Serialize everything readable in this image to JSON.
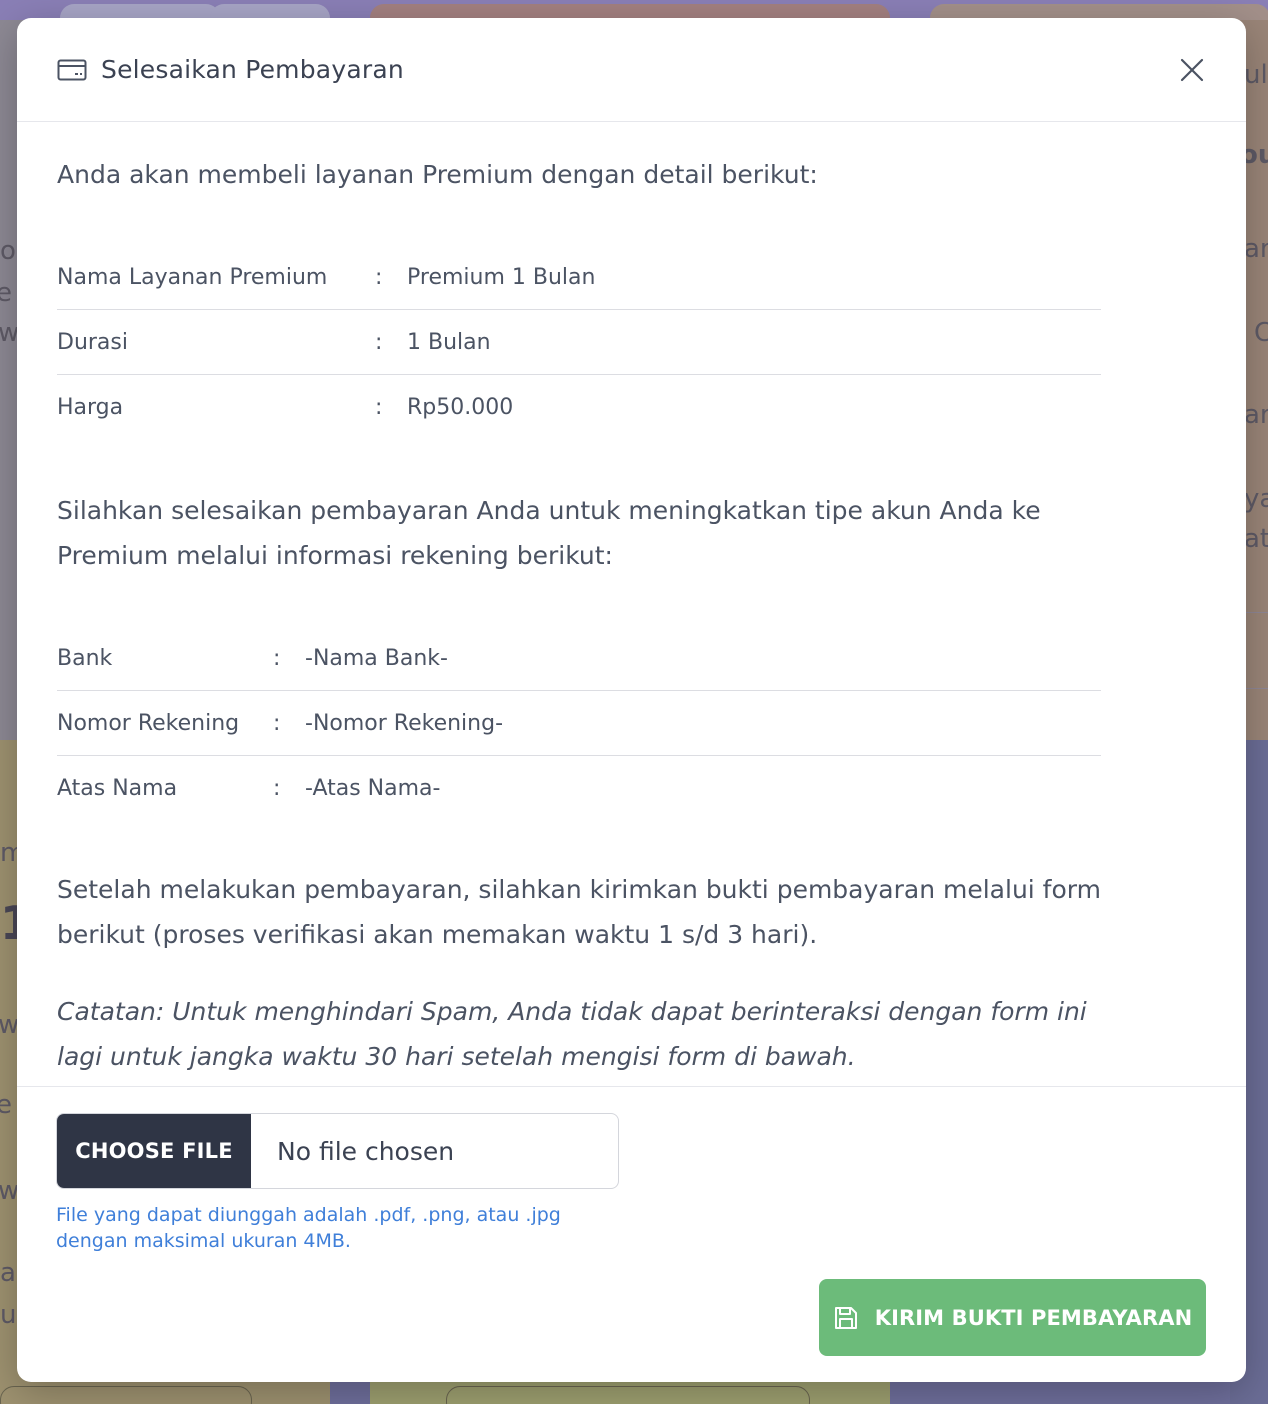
{
  "background": {
    "right_fragments": [
      "ul",
      "ou",
      "an",
      "C",
      "an",
      "ya",
      "at"
    ],
    "left_fragments": [
      "o",
      "e t",
      "w",
      "m",
      "1",
      "w",
      "e t",
      "w",
      "ar",
      "ud"
    ]
  },
  "modal": {
    "title": "Selesaikan Pembayaran",
    "title_icon": "credit-card-icon",
    "close_icon": "close-icon",
    "intro": "Anda akan membeli layanan Premium dengan detail berikut:",
    "service_rows": [
      {
        "key": "Nama Layanan Premium",
        "sep": ":",
        "value": "Premium 1 Bulan"
      },
      {
        "key": "Durasi",
        "sep": ":",
        "value": "1 Bulan"
      },
      {
        "key": "Harga",
        "sep": ":",
        "value": "Rp50.000"
      }
    ],
    "payment_intro": "Silahkan selesaikan pembayaran Anda untuk meningkatkan tipe akun Anda ke Premium melalui informasi rekening berikut:",
    "bank_rows": [
      {
        "key": "Bank",
        "sep": ":",
        "value": "-Nama Bank-"
      },
      {
        "key": "Nomor Rekening",
        "sep": ":",
        "value": "-Nomor Rekening-"
      },
      {
        "key": "Atas Nama",
        "sep": ":",
        "value": "-Atas Nama-"
      }
    ],
    "after_payment": "Setelah melakukan pembayaran, silahkan kirimkan bukti pembayaran melalui form berikut (proses verifikasi akan memakan waktu 1 s/d 3 hari).",
    "note": "Catatan: Untuk menghindari Spam, Anda tidak dapat berinteraksi dengan form ini lagi untuk jangka waktu 30 hari setelah mengisi form di bawah.",
    "file": {
      "button_label": "CHOOSE FILE",
      "status": "No file chosen",
      "hint": "File yang dapat diunggah adalah .pdf, .png, atau .jpg dengan maksimal ukuran 4MB."
    },
    "submit": {
      "label": "KIRIM BUKTI PEMBAYARAN",
      "icon": "save-icon"
    }
  },
  "colors": {
    "overlay": "#6f6f9c",
    "submit_green": "#6cbb7a",
    "file_button_dark": "#2f3545",
    "hint_blue": "#3f7fd9"
  }
}
